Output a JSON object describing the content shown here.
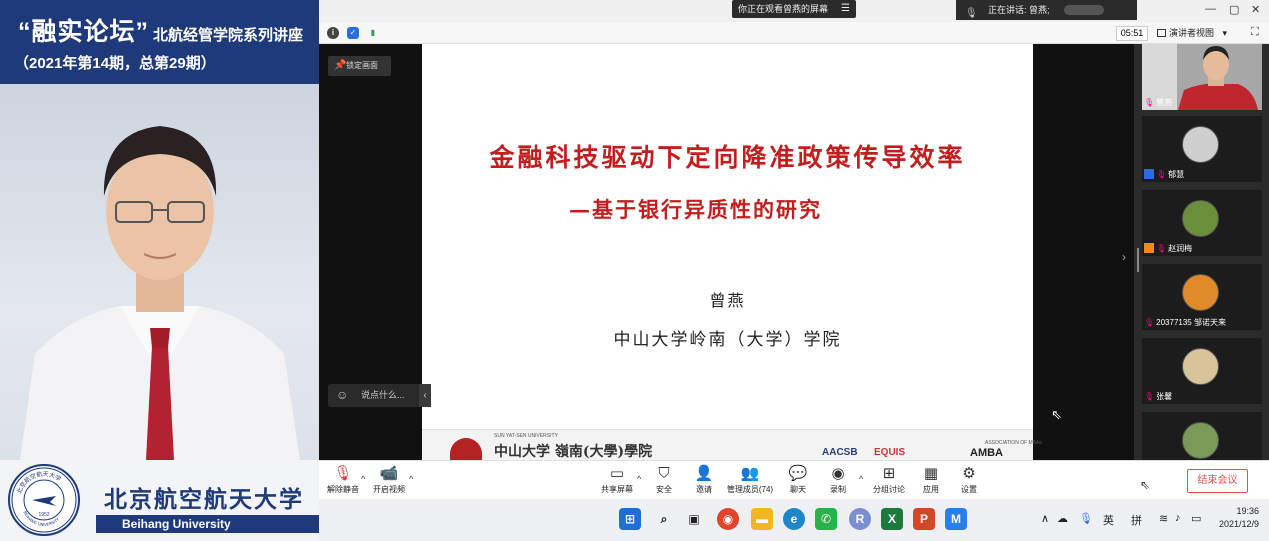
{
  "promo": {
    "series_title": "“融实论坛”",
    "series_subtitle": "北航经管学院系列讲座",
    "issue": "（2021年第14期，总第29期）",
    "university_cn": "北京航空航天大学",
    "university_en": "Beihang University",
    "seal_text": "北京航空航天大学",
    "seal_text_en": "BEIHANG UNIVERSITY",
    "seal_year": "1952"
  },
  "titlebar": {
    "sharing_text": "你正在观看曾燕的屏幕",
    "sharing_menu_icon": "menu-icon",
    "speaking_text": "正在讲话: 曾燕;",
    "window_controls": [
      "—",
      "▢",
      "✕"
    ]
  },
  "statusbar": {
    "timer": "05:51",
    "view_label": "演讲者视图",
    "view_caret": "▾"
  },
  "share": {
    "lock_label": "锁定画面",
    "chat_placeholder": "说点什么..."
  },
  "slide": {
    "title": "金融科技驱动下定向降准政策传导效率",
    "subtitle": "—基于银行异质性的研究",
    "author": "曾燕",
    "affiliation": "中山大学岭南（大学）学院",
    "footer": {
      "sysu_en": "SUN YAT-SEN UNIVERSITY",
      "sysu_cn": "中山大学 嶺南(大學)學院",
      "aacsb": "AACSB",
      "equis": "EQUIS",
      "amba_assoc": "ASSOCIATION OF MBAs",
      "amba": "AMBA"
    }
  },
  "participants": [
    {
      "name": "曾燕",
      "kind": "video"
    },
    {
      "name": "郁慧",
      "kind": "avatar",
      "host": true
    },
    {
      "name": "赵润梅",
      "kind": "avatar",
      "host": true
    },
    {
      "name": "20377135 邹诺天来",
      "kind": "avatar"
    },
    {
      "name": "张馨",
      "kind": "avatar"
    },
    {
      "name": "",
      "kind": "avatar"
    }
  ],
  "toolbar": {
    "unmute": "解除静音",
    "start_video": "开启视频",
    "share_screen": "共享屏幕",
    "security": "安全",
    "invite": "邀请",
    "manage_members": "管理成员(74)",
    "chat": "聊天",
    "record": "录制",
    "breakout": "分组讨论",
    "apps": "应用",
    "settings": "设置",
    "end_meeting": "结束会议"
  },
  "taskbar": {
    "tray_chevron": "∧",
    "ime_lang": "英",
    "ime_mode": "拼",
    "time": "19:36",
    "date": "2021/12/9"
  },
  "colors": {
    "promo_blue": "#1f3a7a",
    "slide_red": "#c31e1e",
    "end_red": "#e94f4f"
  }
}
